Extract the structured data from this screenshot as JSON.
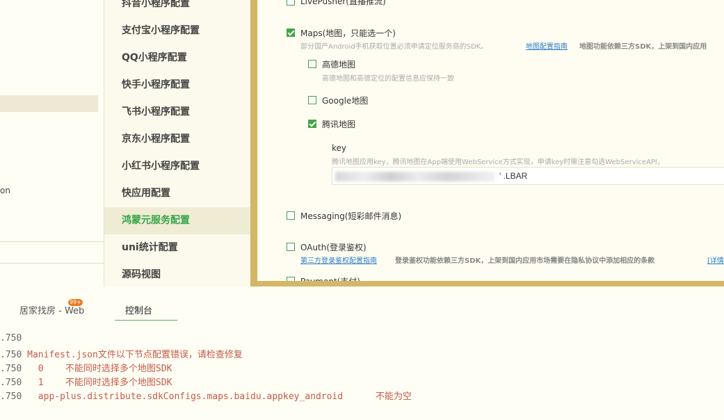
{
  "left_tree": {
    "truncated_text": "on"
  },
  "config_nav": {
    "items": [
      {
        "label": "抖音小程序配置"
      },
      {
        "label": "支付宝小程序配置"
      },
      {
        "label": "QQ小程序配置"
      },
      {
        "label": "快手小程序配置"
      },
      {
        "label": "飞书小程序配置"
      },
      {
        "label": "京东小程序配置"
      },
      {
        "label": "小红书小程序配置"
      },
      {
        "label": "快应用配置"
      },
      {
        "label": "鸿蒙元服务配置"
      },
      {
        "label": "uni统计配置"
      },
      {
        "label": "源码视图"
      }
    ],
    "active_index": 8
  },
  "main": {
    "livepusher_label": "LivePusher(直播推流)",
    "maps": {
      "label": "Maps(地图，只能选一个)",
      "desc": "部分国产Android手机获取位置必须申请定位服务商的SDK。",
      "link": "地图配置指南",
      "desc2": "地图功能依赖三方SDK，上架到国内应用",
      "checked": true
    },
    "amap": {
      "label": "高德地图",
      "desc": "高德地图和高德定位的配置信息应保持一致",
      "checked": false
    },
    "google": {
      "label": "Google地图",
      "checked": false
    },
    "tencent": {
      "label": "腾讯地图",
      "checked": true
    },
    "key": {
      "label": "key",
      "desc": "腾讯地图应用key，腾讯地图在App端使用WebService方式实现，申请key时需注意勾选WebServiceAPI，",
      "value_visible": "' .LBAR"
    },
    "messaging": {
      "label": "Messaging(短彩邮件消息)",
      "checked": false
    },
    "oauth": {
      "label": "OAuth(登录鉴权)",
      "link": "第三方登录鉴权配置指南",
      "desc": "登录鉴权功能依赖三方SDK，上架到国内应用市场需要在隐私协议中添加相应的条款",
      "link2": "[详情",
      "checked": false
    },
    "payment_label": "Payment(支付)"
  },
  "console": {
    "tabs": [
      {
        "label": "居家找房 - Web",
        "badge": "99+"
      },
      {
        "label": "控制台"
      }
    ],
    "active_tab": 1,
    "lines": [
      {
        "time": ".750",
        "msg": ""
      },
      {
        "time": ".750",
        "msg": "Manifest.json文件以下节点配置错误，请检查修复"
      },
      {
        "time": ".750",
        "msg": "  0    不能同时选择多个地图SDK"
      },
      {
        "time": ".750",
        "msg": "  1    不能同时选择多个地图SDK"
      },
      {
        "time": ".750",
        "msg": "  app-plus.distribute.sdkConfigs.maps.baidu.appkey_android      不能为空"
      }
    ],
    "colors": {
      "timestamp": "#666666",
      "error": "#c55a48"
    }
  },
  "colors": {
    "accent": "#d4b766",
    "active_nav": "#38a549",
    "checkbox": "#43a447",
    "link": "#2d7fc9"
  }
}
